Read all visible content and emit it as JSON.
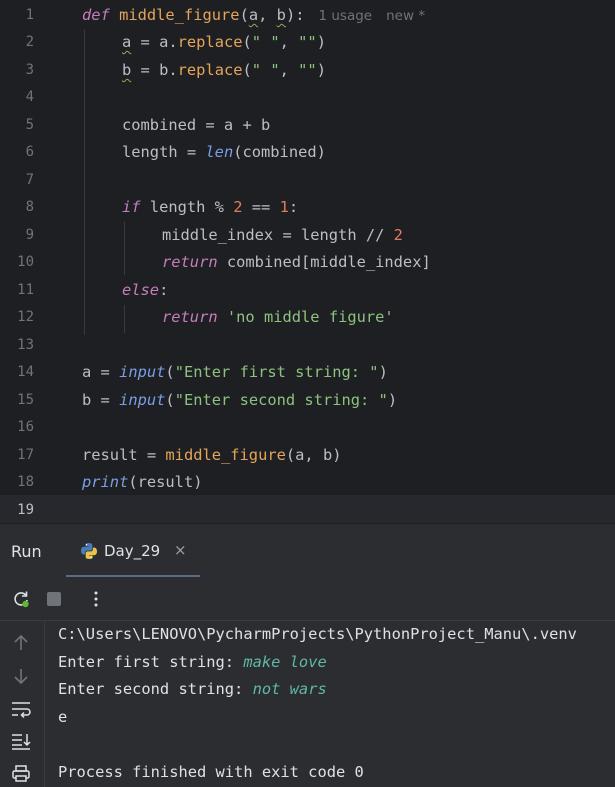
{
  "editor": {
    "line_numbers": [
      "1",
      "2",
      "3",
      "4",
      "5",
      "6",
      "7",
      "8",
      "9",
      "10",
      "11",
      "12",
      "13",
      "14",
      "15",
      "16",
      "17",
      "18",
      "19"
    ],
    "inlay_hint_usage": "1 usage",
    "inlay_hint_new": "new *",
    "lines": {
      "l1": {
        "kw": "def",
        "name": "middle_figure",
        "open": "(",
        "p1": "a",
        "sep": ", ",
        "p2": "b",
        "close": "):"
      },
      "l2": {
        "var": "a",
        "mid": " = a.",
        "fn": "replace",
        "args_open": "(",
        "s1": "\" \"",
        "comma": ", ",
        "s2": "\"\"",
        "args_close": ")"
      },
      "l3": {
        "var": "b",
        "mid": " = b.",
        "fn": "replace",
        "args_open": "(",
        "s1": "\" \"",
        "comma": ", ",
        "s2": "\"\"",
        "args_close": ")"
      },
      "l5": {
        "text": "combined = a + b"
      },
      "l6": {
        "pre": "length = ",
        "fn": "len",
        "post": "(combined)"
      },
      "l8": {
        "kw": "if",
        "pre": " length % ",
        "n1": "2",
        "mid": " == ",
        "n2": "1",
        "post": ":"
      },
      "l9": {
        "pre": "middle_index = length // ",
        "n": "2"
      },
      "l10": {
        "kw": "return",
        "post": " combined[middle_index]"
      },
      "l11": {
        "kw": "else",
        "post": ":"
      },
      "l12": {
        "kw": "return",
        "sp": " ",
        "s": "'no middle figure'"
      },
      "l14": {
        "pre": "a = ",
        "fn": "input",
        "open": "(",
        "s": "\"Enter first string: \"",
        "close": ")"
      },
      "l15": {
        "pre": "b = ",
        "fn": "input",
        "open": "(",
        "s": "\"Enter second string: \"",
        "close": ")"
      },
      "l17": {
        "pre": "result = ",
        "fn": "middle_figure",
        "post": "(a, b)"
      },
      "l18": {
        "fn": "print",
        "post": "(result)"
      }
    }
  },
  "run_panel": {
    "title": "Run",
    "tab_label": "Day_29",
    "tab_close": "×",
    "icons": [
      "rerun-icon",
      "stop-icon",
      "more-icon",
      "arrow-up-icon",
      "arrow-down-icon",
      "soft-wrap-icon",
      "scroll-to-end-icon",
      "print-icon",
      "python-icon"
    ],
    "console": {
      "line1": "C:\\Users\\LENOVO\\PycharmProjects\\PythonProject_Manu\\.venv",
      "prompt1": "Enter first string: ",
      "input1": "make love",
      "prompt2": "Enter second string: ",
      "input2": "not wars",
      "result": "e",
      "finished": "Process finished with exit code 0"
    }
  },
  "colors": {
    "editor_bg": "#1e1f22",
    "panel_bg": "#2b2d30",
    "keyword": "#c77dbb",
    "function": "#e5a45a",
    "builtin": "#7a9ee6",
    "string": "#8dc27e",
    "number": "#e07a5f"
  }
}
